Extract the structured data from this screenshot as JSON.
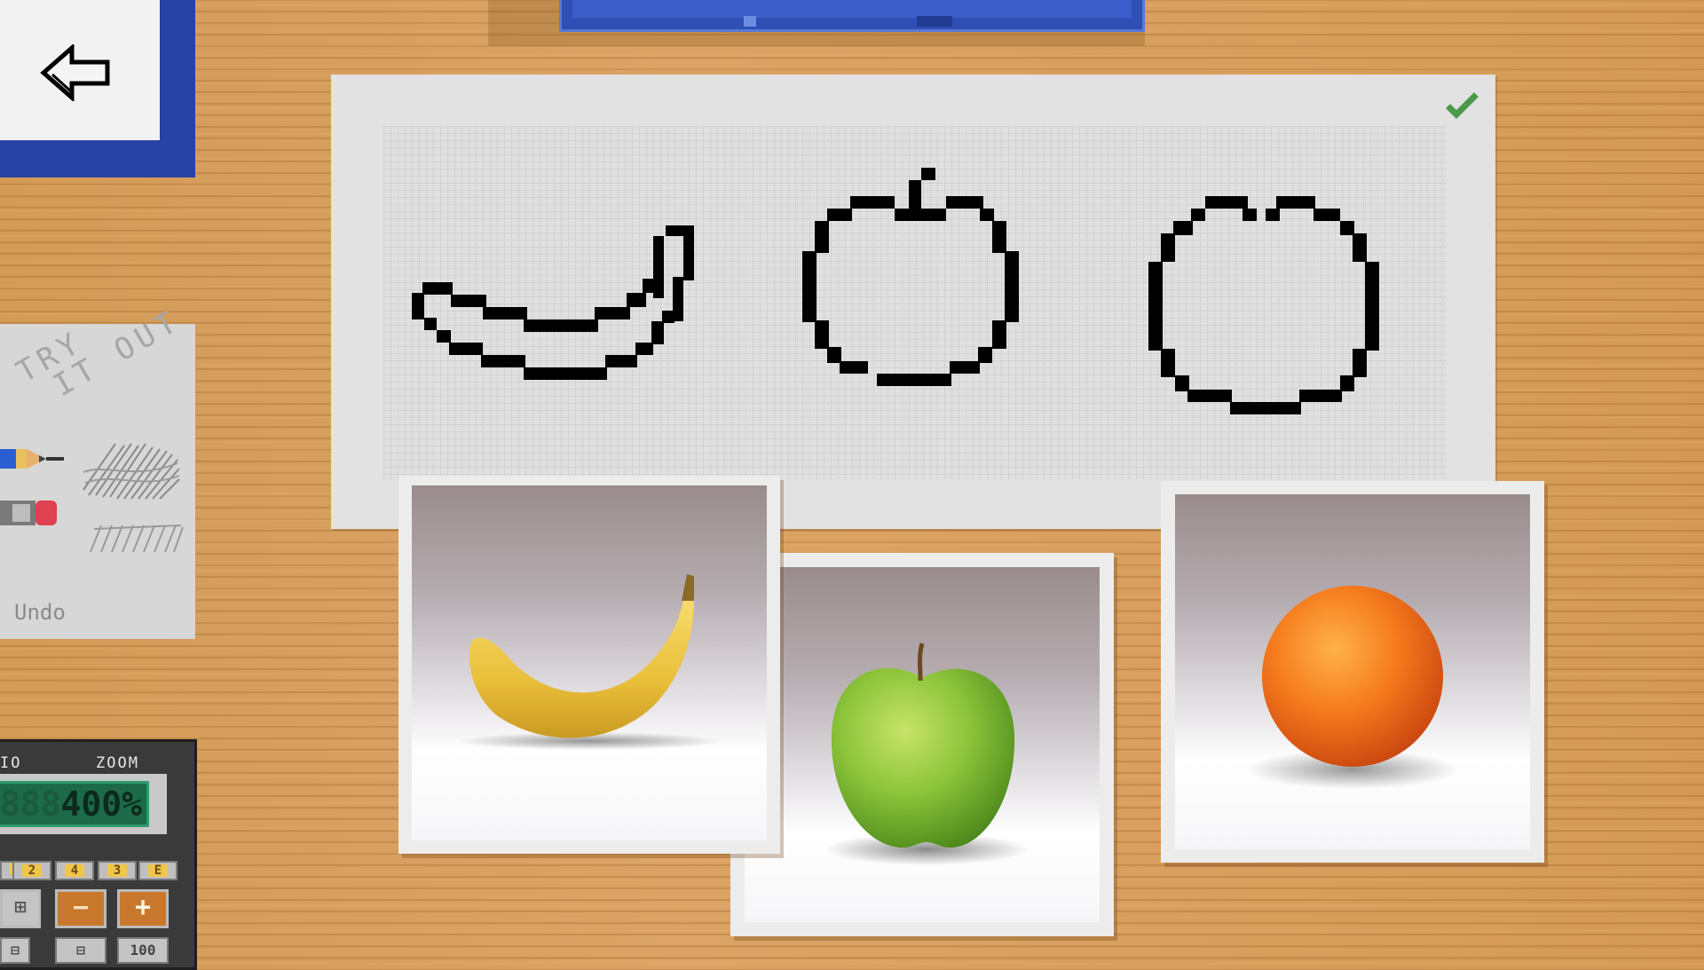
{
  "back_button": {
    "icon": "back-arrow-icon"
  },
  "paper": {
    "check_icon": "checkmark-icon",
    "check_color": "#4a9a4a",
    "sketches": [
      "banana-sketch",
      "apple-sketch",
      "orange-sketch"
    ]
  },
  "tryout": {
    "title_line1": "TRY",
    "title_line2": "IT OUT",
    "undo_label": "Undo",
    "tools": [
      "pencil-icon",
      "eraser-icon"
    ]
  },
  "calculator": {
    "label_left": "IO",
    "label_right": "ZOOM",
    "zoom_ghost": "888",
    "zoom_value": "400%",
    "small_keys": [
      "2",
      "4",
      "3",
      "E"
    ],
    "minus_label": "−",
    "plus_label": "+",
    "bottom_keys": [
      "⊟",
      "⊟",
      "100"
    ],
    "colors": {
      "screen": "#1d6a4a",
      "minus": "#c8782c",
      "plus": "#c8782c"
    }
  },
  "photos": [
    {
      "subject": "banana"
    },
    {
      "subject": "green apple"
    },
    {
      "subject": "orange"
    }
  ]
}
